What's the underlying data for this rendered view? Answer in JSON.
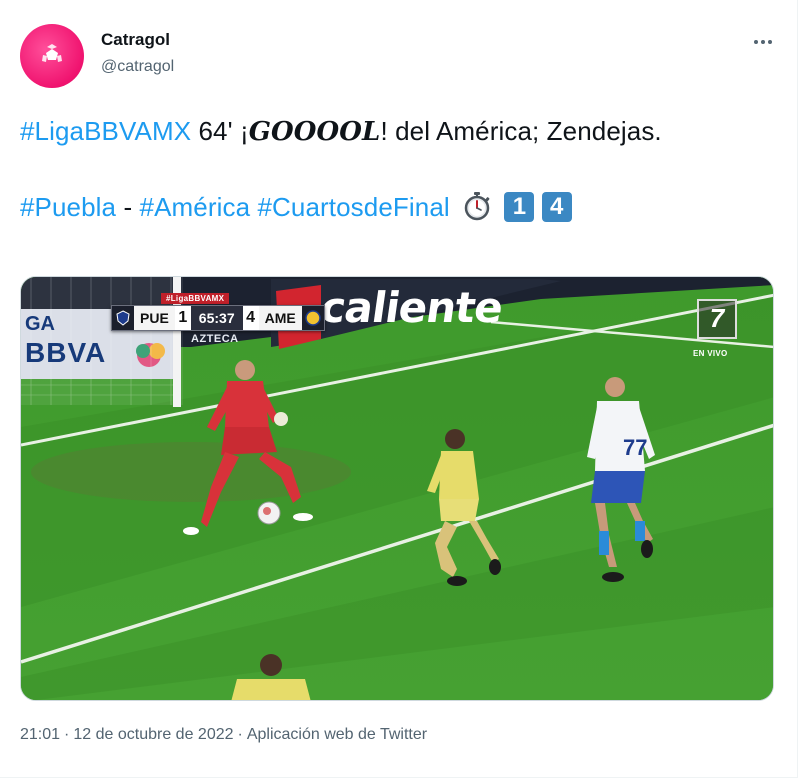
{
  "author": {
    "name": "Catragol",
    "handle": "@catragol",
    "avatar_color": "#f0136f"
  },
  "more_icon": "more-horizontal-icon",
  "tweet": {
    "line1": {
      "hashtag": "#LigaBBVAMX",
      "minute": " 64' ¡",
      "goal": "GOOOOL",
      "rest": "! del América; Zendejas."
    },
    "line2": {
      "hashtag_puebla": "#Puebla",
      "dash": " - ",
      "hashtag_america": "#América",
      "hashtag_cuartos": "#CuartosdeFinal",
      "stopwatch_icon": "stopwatch-icon",
      "score_left": "1",
      "score_right": "4"
    }
  },
  "media": {
    "scoreboard": {
      "top_label": "#LigaBBVAMX",
      "home_team": "PUE",
      "home_score": "1",
      "clock": "65:37",
      "away_score": "4",
      "away_team": "AME"
    },
    "ads": {
      "caliente": "caliente",
      "bbva": "BBVA",
      "ga": "GA",
      "azteca": "AZTECA"
    },
    "broadcaster": {
      "logo": "7",
      "label": "EN VIVO"
    },
    "jersey_number": "77"
  },
  "footer": {
    "time": "21:01",
    "separator": "·",
    "date": "12 de octubre de 2022",
    "source": "Aplicación web de Twitter"
  },
  "colors": {
    "link": "#1d9bf0",
    "secondary_text": "#536471",
    "keycap": "#3b88c3"
  }
}
